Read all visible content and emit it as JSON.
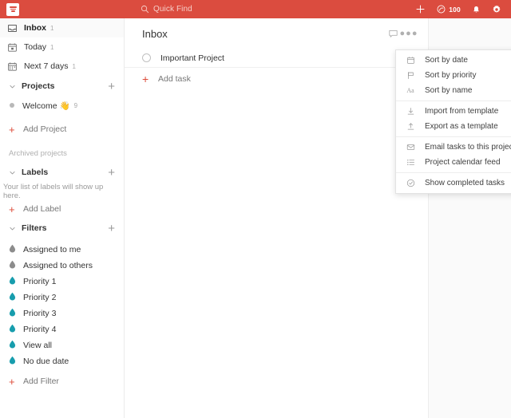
{
  "colors": {
    "brand": "#db4c3f",
    "accent_red": "#dd4b39",
    "filter_teal": "#179dad",
    "filter_gray": "#8c8c8c",
    "sidebar_border": "#ebebeb",
    "panel_gray": "#fafafa"
  },
  "topbar": {
    "logo_name": "todoist-logo",
    "search": {
      "placeholder": "Quick Find",
      "value": "Quick Find",
      "icon": "search-icon"
    },
    "actions": [
      {
        "name": "add-task-button",
        "icon": "plus-icon"
      },
      {
        "name": "karma-button",
        "icon": "karma-icon",
        "count": "100"
      },
      {
        "name": "notifications-button",
        "icon": "bell-icon"
      },
      {
        "name": "settings-button",
        "icon": "gear-icon"
      }
    ]
  },
  "sidebar": {
    "nav": [
      {
        "label": "Inbox",
        "count": "1",
        "icon": "inbox-icon",
        "selected": true
      },
      {
        "label": "Today",
        "count": "1",
        "icon": "calendar-today-icon",
        "selected": false
      },
      {
        "label": "Next 7 days",
        "count": "1",
        "icon": "calendar-week-icon",
        "selected": false
      }
    ],
    "projects": {
      "title": "Projects",
      "add_icon": "plus-icon",
      "caret_icon": "chevron-down-icon",
      "items": [
        {
          "label": "Welcome 👋",
          "count": "9",
          "dot_color": "#b8b8b8"
        }
      ],
      "add_label": "Add Project",
      "archived_label": "Archived projects"
    },
    "labels": {
      "title": "Labels",
      "add_icon": "plus-icon",
      "caret_icon": "chevron-down-icon",
      "empty_hint": "Your list of labels will show up here.",
      "add_label": "Add Label"
    },
    "filters": {
      "title": "Filters",
      "add_icon": "plus-icon",
      "caret_icon": "chevron-down-icon",
      "items": [
        {
          "label": "Assigned to me",
          "color": "#8c8c8c"
        },
        {
          "label": "Assigned to others",
          "color": "#8c8c8c"
        },
        {
          "label": "Priority 1",
          "color": "#179dad"
        },
        {
          "label": "Priority 2",
          "color": "#179dad"
        },
        {
          "label": "Priority 3",
          "color": "#179dad"
        },
        {
          "label": "Priority 4",
          "color": "#179dad"
        },
        {
          "label": "View all",
          "color": "#179dad"
        },
        {
          "label": "No due date",
          "color": "#179dad"
        }
      ],
      "add_label": "Add Filter"
    }
  },
  "main": {
    "title": "Inbox",
    "comment_icon": "comment-icon",
    "more_icon": "more-options-icon",
    "more_label": "●●●",
    "tasks": [
      {
        "text": "Important Project",
        "completed": false
      }
    ],
    "add_task_label": "Add task"
  },
  "menu": {
    "groups": [
      [
        {
          "label": "Sort by date",
          "icon": "calendar-icon"
        },
        {
          "label": "Sort by priority",
          "icon": "flag-icon"
        },
        {
          "label": "Sort by name",
          "icon": "aa-text-icon"
        }
      ],
      [
        {
          "label": "Import from template",
          "icon": "download-icon"
        },
        {
          "label": "Export as a template",
          "icon": "upload-icon"
        }
      ],
      [
        {
          "label": "Email tasks to this project",
          "icon": "envelope-icon"
        },
        {
          "label": "Project calendar feed",
          "icon": "list-icon"
        }
      ],
      [
        {
          "label": "Show completed tasks",
          "icon": "check-circle-icon"
        }
      ]
    ]
  }
}
